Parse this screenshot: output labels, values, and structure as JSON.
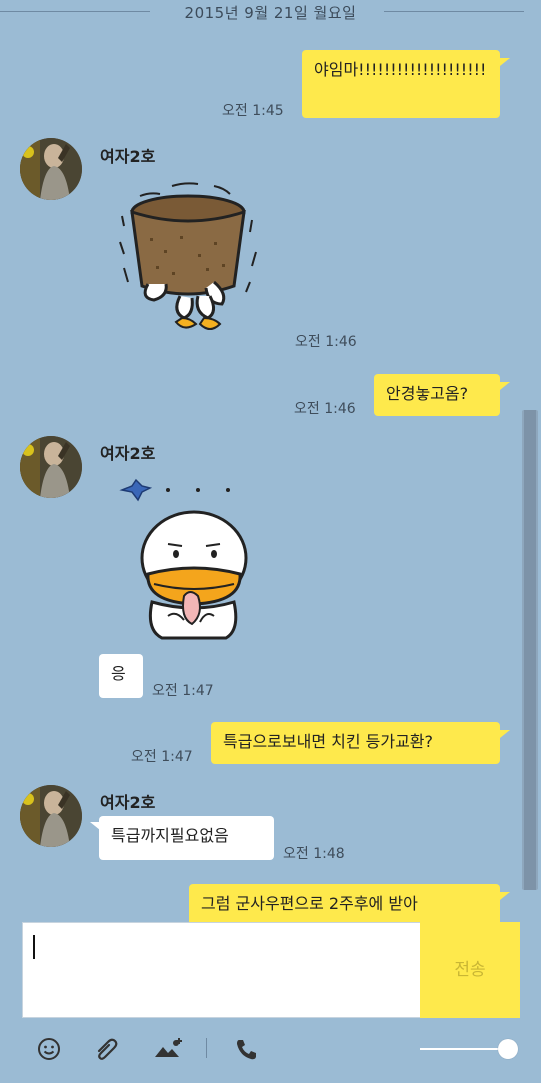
{
  "date_divider": "2015년 9월 21일 월요일",
  "messages": [
    {
      "text": "야임마!!!!!!!!!!!!!!!!!!!!",
      "time": "오전 1:45"
    },
    {
      "sender": "여자2호",
      "sticker": "head-in-basket-sticker",
      "time": "오전 1:46"
    },
    {
      "text": "안경놓고옴?",
      "time": "오전 1:46"
    },
    {
      "sender": "여자2호",
      "sticker": "thinking-duck-sticker"
    },
    {
      "text": "응",
      "time": "오전 1:47"
    },
    {
      "text": "특급으로보내면 치킨 등가교환?",
      "time": "오전 1:47"
    },
    {
      "sender": "여자2호",
      "text": "특급까지필요없음",
      "time": "오전 1:48"
    },
    {
      "text": "그럼 군사우편으로 2주후에 받아"
    }
  ],
  "composer": {
    "send_label": "전송"
  },
  "toolbar": {
    "icons": [
      "emoji-icon",
      "attach-icon",
      "photo-icon",
      "call-icon"
    ]
  },
  "colors": {
    "background": "#9bbbd4",
    "my_bubble": "#fee94c",
    "other_bubble": "#ffffff"
  }
}
